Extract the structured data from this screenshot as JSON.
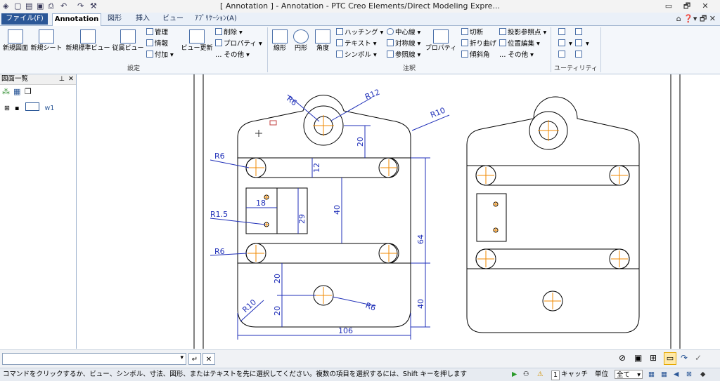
{
  "window": {
    "title": "[ Annotation ] - Annotation - PTC Creo Elements/Direct Modeling Expre...",
    "controls": [
      "▭",
      "🗗",
      "✕"
    ]
  },
  "tabs": [
    {
      "label": "ファイル(F)"
    },
    {
      "label": "Annotation"
    },
    {
      "label": "図形"
    },
    {
      "label": "挿入"
    },
    {
      "label": "ビュー"
    },
    {
      "label": "ｱﾌﾟﾘｹｰｼｮﾝ(A)"
    }
  ],
  "ribbon": {
    "groups": {
      "settings": "設定",
      "annotation": "注釈",
      "utility": "ユーティリティ"
    },
    "big_buttons": {
      "new_drawing": "新規図面",
      "new_sheet": "新規シート",
      "new_std_view": "新規標準ビュー",
      "sub_view": "従属ビュー",
      "view_update": "ビュー更新",
      "linear": "線形",
      "circle": "円形",
      "angle": "角度",
      "properties": "プロパティ"
    },
    "small_buttons": {
      "manage": "管理",
      "info": "情報",
      "attach": "付加",
      "delete": "削除",
      "property": "プロパティ",
      "other1": "その他",
      "hatching": "ハッチング",
      "text": "テキスト",
      "symbol": "シンボル",
      "centerline": "中心線",
      "symmetric": "対称線",
      "reference": "参照線",
      "cut": "切断",
      "fold": "折り曲げ",
      "inclined": "傾斜角",
      "proj_ref": "投影参照点",
      "position": "位置編集",
      "other2": "その他"
    }
  },
  "left_panel": {
    "title": "図面一覧",
    "tree_item": "w1"
  },
  "drawing": {
    "labels": {
      "r6_top": "R6",
      "r12": "R12",
      "r10_top": "R10",
      "r6_left": "R6",
      "r15": "R1.5",
      "r6_left2": "R6",
      "r10_bottom": "R10",
      "r6_bottom": "R6",
      "d20_top": "20",
      "d12": "12",
      "d18": "18",
      "d29": "29",
      "d40_mid": "40",
      "d64": "64",
      "d20_a": "20",
      "d20_b": "20",
      "d40_right": "40",
      "d106": "106"
    },
    "colors": {
      "dimension": "#1f2fb8",
      "center": "#f08a00",
      "outline": "#000000"
    }
  },
  "statusbar": {
    "message": "コマンドをクリックするか、ビュー、シンボル、寸法、図形、またはテキストを先に選択してください。複数の項目を選択するには、Shift キーを押します",
    "count": "1",
    "cancel": "キャッチ",
    "unit_label": "単位",
    "filter": "全て"
  }
}
